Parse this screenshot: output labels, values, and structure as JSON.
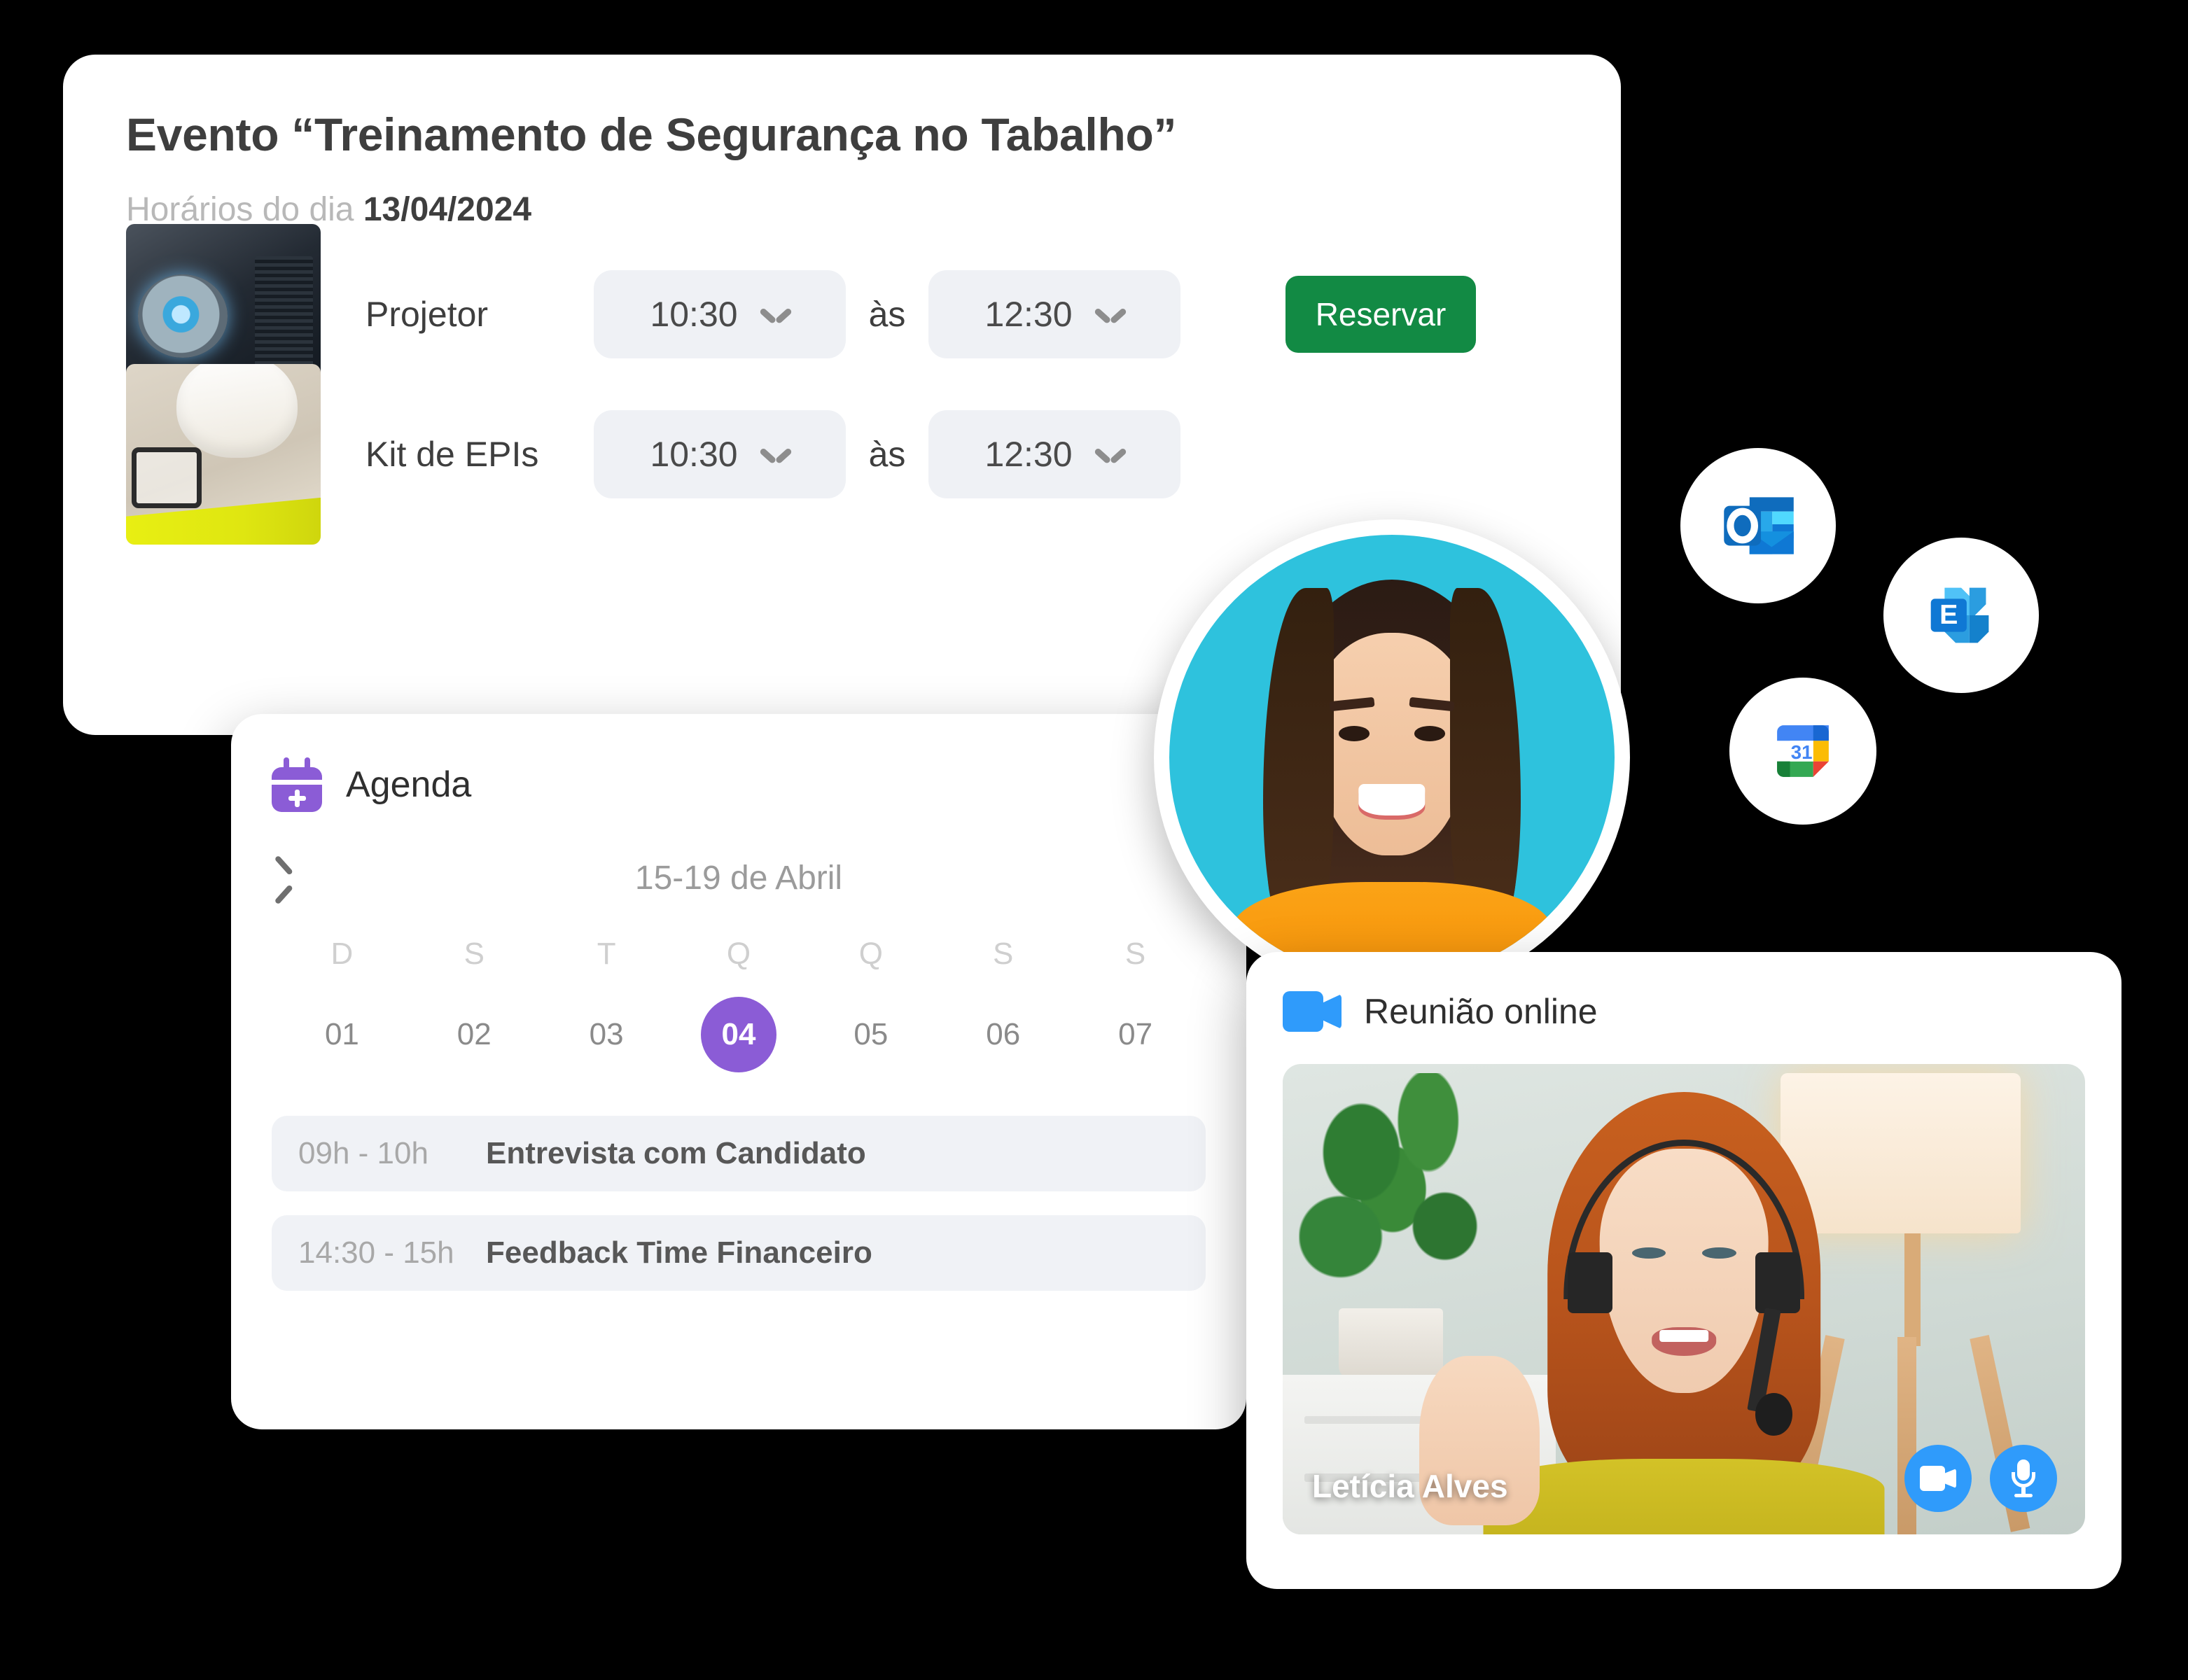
{
  "event_card": {
    "title": "Evento “Treinamento de Segurança no Tabalho”",
    "subtitle_label": "Horários do dia",
    "subtitle_date": "13/04/2024",
    "separator_word": "às",
    "reserve_label": "Reservar",
    "rows": [
      {
        "name": "Projetor",
        "start": "10:30",
        "end": "12:30",
        "thumb": "projector-photo"
      },
      {
        "name": "Kit de EPIs",
        "start": "10:30",
        "end": "12:30",
        "thumb": "epi-kit-photo"
      }
    ]
  },
  "agenda_card": {
    "title": "Agenda",
    "icon": "calendar-plus-icon",
    "prev_icon": "chevron-left-icon",
    "week_range": "15-19 de Abril",
    "day_initials": [
      "D",
      "S",
      "T",
      "Q",
      "Q",
      "S",
      "S"
    ],
    "dates": [
      "01",
      "02",
      "03",
      "04",
      "05",
      "06",
      "07"
    ],
    "selected_date": "04",
    "accent_color": "#8b5cd6",
    "events": [
      {
        "time": "09h - 10h",
        "name": "Entrevista com Candidato"
      },
      {
        "time": "14:30 - 15h",
        "name": "Feedback Time Financeiro"
      }
    ]
  },
  "meeting_card": {
    "title": "Reunião online",
    "icon": "video-camera-icon",
    "participant_name": "Letícia Alves",
    "controls": [
      {
        "icon": "camera-icon",
        "name": "toggle-camera"
      },
      {
        "icon": "microphone-icon",
        "name": "toggle-microphone"
      }
    ],
    "accent_color": "#2f9bfb"
  },
  "avatar": {
    "icon": "user-avatar-photo"
  },
  "integrations": [
    {
      "icon": "microsoft-outlook-icon",
      "name": "Outlook"
    },
    {
      "icon": "microsoft-exchange-icon",
      "name": "Exchange"
    },
    {
      "icon": "google-calendar-icon",
      "name": "Google Calendar",
      "badge_number": "31"
    }
  ],
  "colors": {
    "background": "#000000",
    "card": "#ffffff",
    "reserve_green": "#128a44",
    "purple": "#8b5cd6",
    "blue": "#2f9bfb",
    "field_grey": "#eff1f5"
  }
}
